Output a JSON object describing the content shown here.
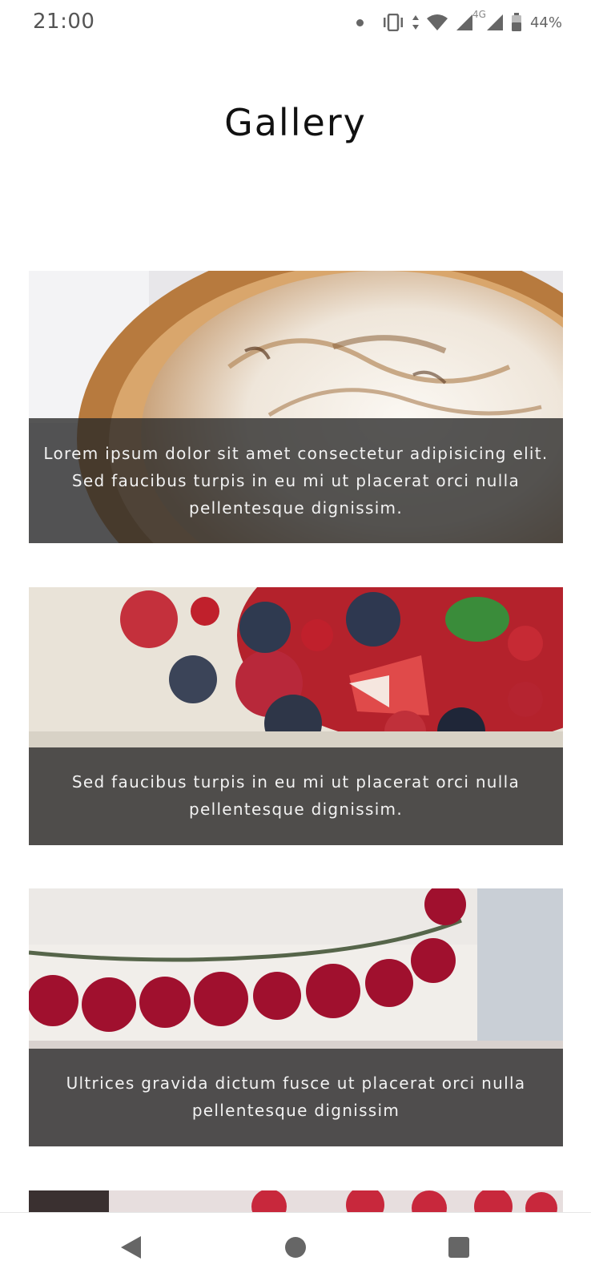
{
  "status_bar": {
    "time": "21:00",
    "network_type": "4G",
    "battery_percent": "44%",
    "icons": [
      "notification-dot-icon",
      "vibrate-icon",
      "data-arrows-icon",
      "wifi-icon",
      "signal-icon",
      "signal-icon",
      "battery-icon"
    ]
  },
  "page": {
    "title": "Gallery"
  },
  "gallery": {
    "items": [
      {
        "image": "meringue-pie-photo",
        "caption": "Lorem ipsum dolor sit amet consectetur adipisicing elit. Sed faucibus turpis in eu mi ut placerat orci nulla pellentesque dignissim."
      },
      {
        "image": "berry-cake-photo",
        "caption": "Sed faucibus turpis in eu mi ut placerat orci nulla pellentesque dignissim."
      },
      {
        "image": "cranberry-cake-photo",
        "caption": "Ultrices gravida dictum fusce ut placerat orci nulla pellentesque dignissim"
      },
      {
        "image": "raspberry-cake-photo",
        "caption": ""
      }
    ]
  },
  "nav_bar": {
    "buttons": [
      "back-icon",
      "home-icon",
      "recents-icon"
    ]
  }
}
